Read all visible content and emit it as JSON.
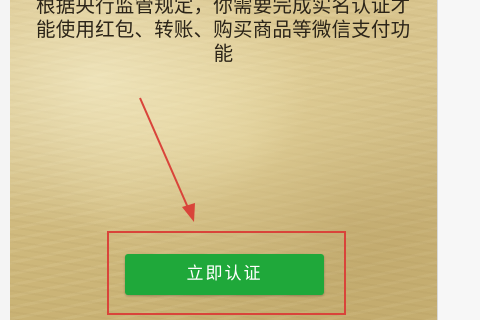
{
  "notice": {
    "lines": [
      "根据央行监管规定，你需要完成实名认证才",
      "能使用红包、转账、购买商品等微信支付功",
      "能"
    ]
  },
  "verify_button": {
    "label": "立即认证"
  },
  "annotation": {
    "arrow_color": "#d9443a",
    "box_color": "#d9443a"
  },
  "colors": {
    "button_green": "#1fa83a",
    "parchment": "#d6c28a",
    "text": "#2b2418"
  }
}
